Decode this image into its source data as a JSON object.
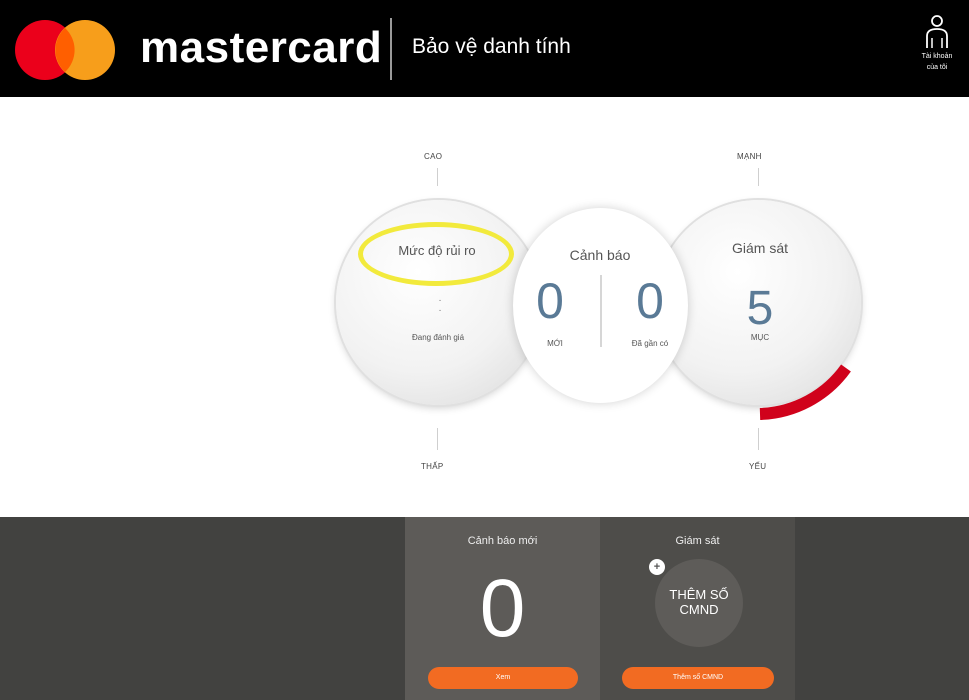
{
  "header": {
    "brand": "mastercard",
    "subtitle": "Bảo vệ danh tính",
    "account_label_line1": "Tài khoản",
    "account_label_line2": "của tôi",
    "colors": {
      "logo_red": "#eb001b",
      "logo_orange": "#f79e1b",
      "header_bg": "#000000"
    }
  },
  "gauge": {
    "left_top": "CAO",
    "left_bottom": "THẤP",
    "right_top": "MẠNH",
    "right_bottom": "YẾU",
    "risk": {
      "title": "Mức độ rủi ro",
      "dots": "·\n·",
      "status": "Đang đánh giá"
    },
    "alerts": {
      "title": "Cảnh báo",
      "new_value": "0",
      "new_label": "MỚI",
      "seen_value": "0",
      "seen_label": "Đã gần có"
    },
    "monitor": {
      "title": "Giám sát",
      "value": "5",
      "label": "MỤC",
      "level": 0.15
    },
    "highlight_color": "#f2ea3c",
    "accent_red": "#d0021b"
  },
  "bottom": {
    "alerts_panel": {
      "title": "Cảnh báo mới",
      "value": "0",
      "button": "Xem"
    },
    "monitor_panel": {
      "title": "Giám sát",
      "add_badge": "+",
      "add_line1": "THÊM SỐ",
      "add_line2": "CMND",
      "button": "Thêm số CMND"
    },
    "accent": "#f26b22"
  }
}
